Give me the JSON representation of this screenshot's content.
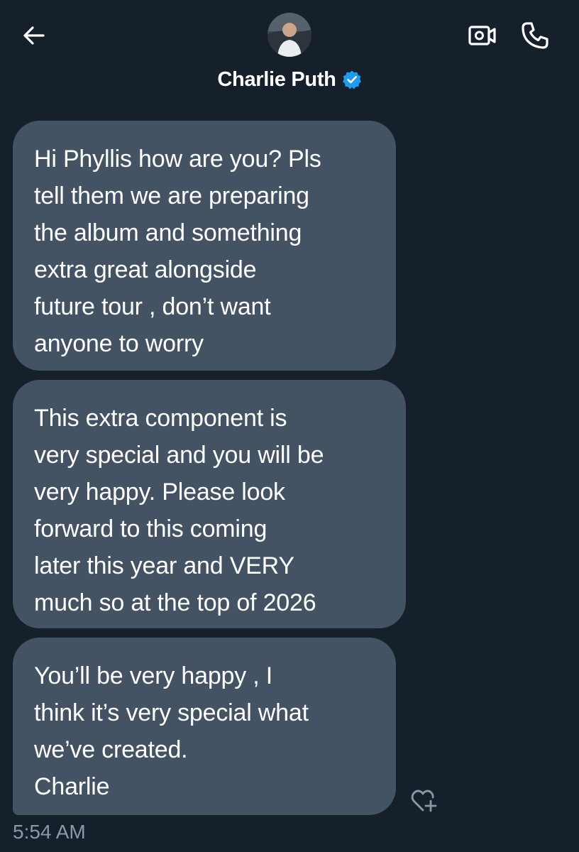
{
  "header": {
    "contact_name": "Charlie Puth",
    "verified": true,
    "icons": {
      "back": "back-arrow-icon",
      "video": "video-call-icon",
      "phone": "phone-call-icon",
      "verified": "verified-badge-icon"
    },
    "verified_color": "#1d9bf0"
  },
  "messages": [
    {
      "text": "Hi Phyllis how are you? Pls\ntell them we are preparing\nthe album and something\nextra great alongside\nfuture tour , don’t want\nanyone to worry"
    },
    {
      "text": "This extra component is\nvery special and you will be\nvery happy. Please look\nforward to this coming\nlater this year and VERY\nmuch so at the top of 2026"
    },
    {
      "text": "You’ll be very happy , I\nthink it’s very special what\nwe’ve created.\nCharlie"
    }
  ],
  "timestamp": "5:54 AM",
  "colors": {
    "background": "#15202b",
    "bubble": "#435363",
    "timestamp": "#8b98a5"
  },
  "reaction_icon": "heart-plus-icon"
}
